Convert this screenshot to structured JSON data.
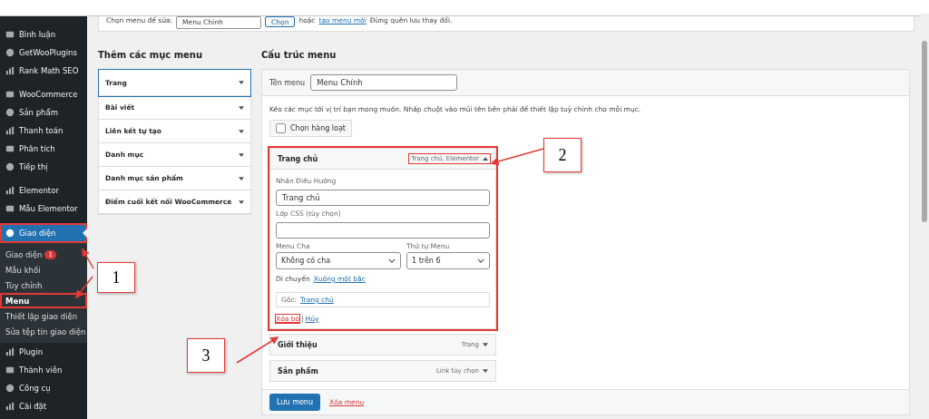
{
  "sidebar": {
    "items": [
      {
        "label": "Bình luận",
        "selected": false
      },
      {
        "label": "GetWooPlugins",
        "selected": false
      },
      {
        "label": "Rank Math SEO",
        "selected": false
      },
      {
        "label": "WooCommerce",
        "selected": false,
        "gap": true
      },
      {
        "label": "Sản phẩm",
        "selected": false
      },
      {
        "label": "Thanh toán",
        "selected": false
      },
      {
        "label": "Phân tích",
        "selected": false
      },
      {
        "label": "Tiếp thị",
        "selected": false
      },
      {
        "label": "Elementor",
        "selected": false,
        "gap": true
      },
      {
        "label": "Mẫu Elementor",
        "selected": false
      },
      {
        "label": "Giao diện",
        "selected": true,
        "highlighted": true,
        "gap": true,
        "children": [
          {
            "label": "Giao diện",
            "selected": false,
            "badge": "1"
          },
          {
            "label": "Mẫu khối",
            "selected": false
          },
          {
            "label": "Tùy chỉnh",
            "selected": false
          },
          {
            "label": "Menu",
            "selected": true,
            "highlighted": true
          },
          {
            "label": "Thiết lập giao diện",
            "selected": false
          },
          {
            "label": "Sửa tệp tin giao diện",
            "selected": false
          }
        ]
      },
      {
        "label": "Plugin",
        "selected": false
      },
      {
        "label": "Thành viên",
        "selected": false
      },
      {
        "label": "Công cụ",
        "selected": false
      },
      {
        "label": "Cài đặt",
        "selected": false
      }
    ]
  },
  "top_bar": {
    "label": "Chọn menu để sửa:",
    "select": "Menu Chính",
    "button": "Chọn",
    "note": "hoặc",
    "link": "tạo menu mới",
    "note_after": "Đừng quên lưu thay đổi."
  },
  "add_items": {
    "title": "Thêm các mục menu",
    "sections": [
      {
        "label": "Trang",
        "selected": true
      },
      {
        "label": "Bài viết",
        "selected": false
      },
      {
        "label": "Liên kết tự tạo",
        "selected": false
      },
      {
        "label": "Danh mục",
        "selected": false
      },
      {
        "label": "Danh mục sản phẩm",
        "selected": false
      },
      {
        "label": "Điểm cuối kết nối WooCommerce",
        "selected": false
      }
    ]
  },
  "structure": {
    "title": "Cấu trúc menu",
    "name_label": "Tên menu",
    "name_value": "Menu Chính",
    "instructions": "Kéo các mục tới vị trí bạn mong muốn. Nhấp chuột vào mũi tên bên phải để thiết lập tuỳ chỉnh cho mỗi mục.",
    "bulk_select": {
      "label": "Chọn hàng loạt",
      "checked": false
    },
    "items": [
      {
        "title": "Trang chủ",
        "type": "Trang chủ, Elementor",
        "expanded": true,
        "highlighted": true,
        "settings": {
          "nav_label": "Nhãn Điều Hướng",
          "nav_value": "Trang chủ",
          "css_label": "Lớp CSS (tùy chọn)",
          "parent_label": "Menu Cha",
          "parent_value": "Không có cha",
          "order_label": "Thứ tự Menu",
          "order_value": "1 trên 6",
          "move_label": "Di chuyển",
          "move_link": "Xuống một bậc",
          "original_label": "Gốc:",
          "original_link": "Trang chủ",
          "remove": "Xóa bỏ",
          "separator": "|",
          "cancel": "Hủy"
        }
      },
      {
        "title": "Giới thiệu",
        "type": "Trang",
        "expanded": false
      },
      {
        "title": "Sản phẩm",
        "type": "Link tùy chọn",
        "expanded": false
      }
    ],
    "save": "Lưu menu",
    "delete": "Xóa menu"
  },
  "annotations": [
    {
      "label": "1"
    },
    {
      "label": "2"
    },
    {
      "label": "3"
    }
  ]
}
